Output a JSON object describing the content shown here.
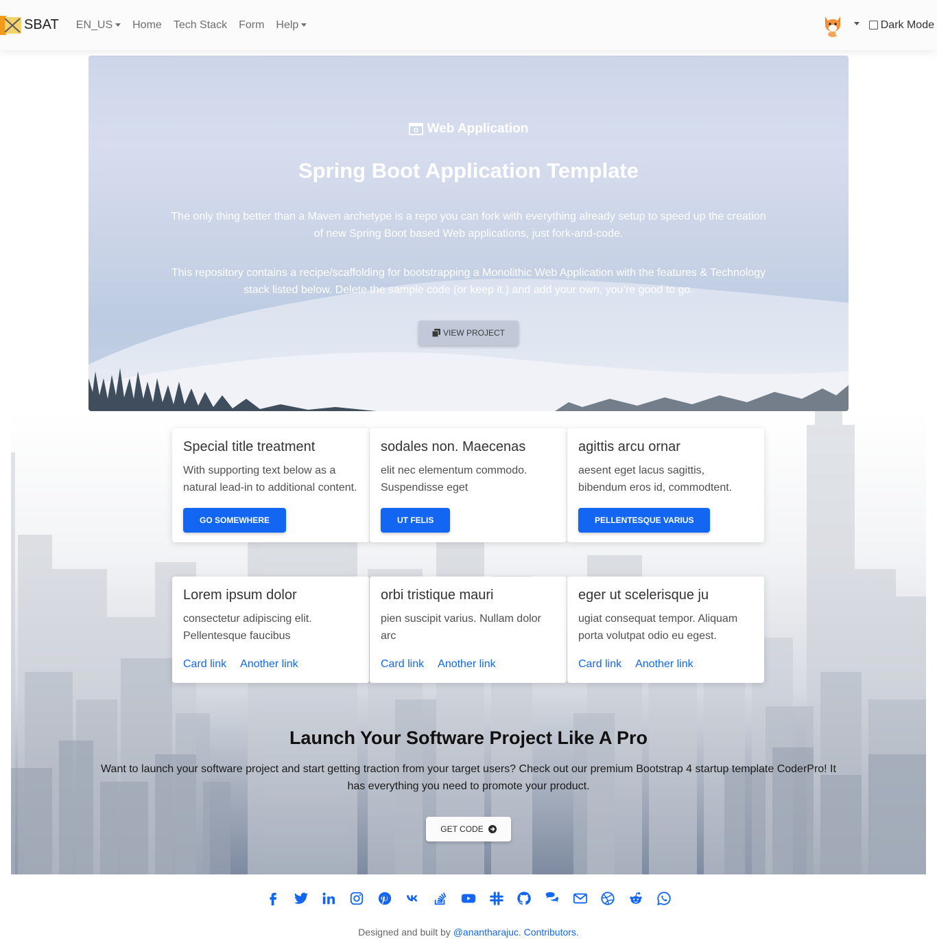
{
  "nav": {
    "brand": "SBAT",
    "items": [
      {
        "label": "EN_US",
        "dropdown": true
      },
      {
        "label": "Home",
        "dropdown": false
      },
      {
        "label": "Tech Stack",
        "dropdown": false
      },
      {
        "label": "Form",
        "dropdown": false
      },
      {
        "label": "Help",
        "dropdown": true
      }
    ],
    "dark_mode_label": "Dark Mode",
    "dark_mode_checked": false
  },
  "hero": {
    "kicker": "Web Application",
    "title": "Spring Boot Application Template",
    "paragraph1": "The only thing better than a Maven archetype is a repo you can fork with everything already setup to speed up the creation of new Spring Boot based Web applications, just fork-and-code.",
    "paragraph2": "This repository contains a recipe/scaffolding for bootstrapping a Monolithic Web Application with the features & Technology stack listed below. Delete the sample code (or keep it.) and add your own, you’re good to go.",
    "button": "VIEW PROJECT"
  },
  "cards": [
    {
      "title": "Special title treatment",
      "text": "With supporting text below as a natural lead-in to additional content.",
      "button": "GO SOMEWHERE"
    },
    {
      "title": "sodales non. Maecenas",
      "text": "elit nec elementum commodo. Suspendisse eget",
      "button": "UT FELIS"
    },
    {
      "title": "agittis arcu ornar",
      "text": "aesent eget lacus sagittis, bibendum eros id, commodtent.",
      "button": "PELLENTESQUE VARIUS"
    },
    {
      "title": "Lorem ipsum dolor",
      "text": "consectetur adipiscing elit. Pellentesque faucibus",
      "link1": "Card link",
      "link2": "Another link"
    },
    {
      "title": "orbi tristique mauri",
      "text": "pien suscipit varius. Nullam dolor arc",
      "link1": "Card link",
      "link2": "Another link"
    },
    {
      "title": "eger ut scelerisque ju",
      "text": "ugiat consequat tempor. Aliquam porta volutpat odio eu egest.",
      "link1": "Card link",
      "link2": "Another link"
    }
  ],
  "launch": {
    "title": "Launch Your Software Project Like A Pro",
    "text": "Want to launch your software project and start getting traction from your target users? Check out our premium Bootstrap 4 startup template CoderPro! It has everything you need to promote your product.",
    "button": "GET CODE"
  },
  "social_icons": [
    "facebook-icon",
    "twitter-icon",
    "linkedin-icon",
    "instagram-icon",
    "pinterest-icon",
    "vk-icon",
    "stackoverflow-icon",
    "youtube-icon",
    "slack-icon",
    "github-icon",
    "chat-icon",
    "email-icon",
    "dribbble-icon",
    "reddit-icon",
    "whatsapp-icon"
  ],
  "footer": {
    "prefix": "Designed and built by ",
    "author": "@anantharajuc",
    "middle": ". ",
    "contributors": "Contributors",
    "suffix": "."
  },
  "colors": {
    "primary": "#1266f1",
    "navbar_bg": "#fbfbfb",
    "hero_sky": "#cdd6ea"
  }
}
